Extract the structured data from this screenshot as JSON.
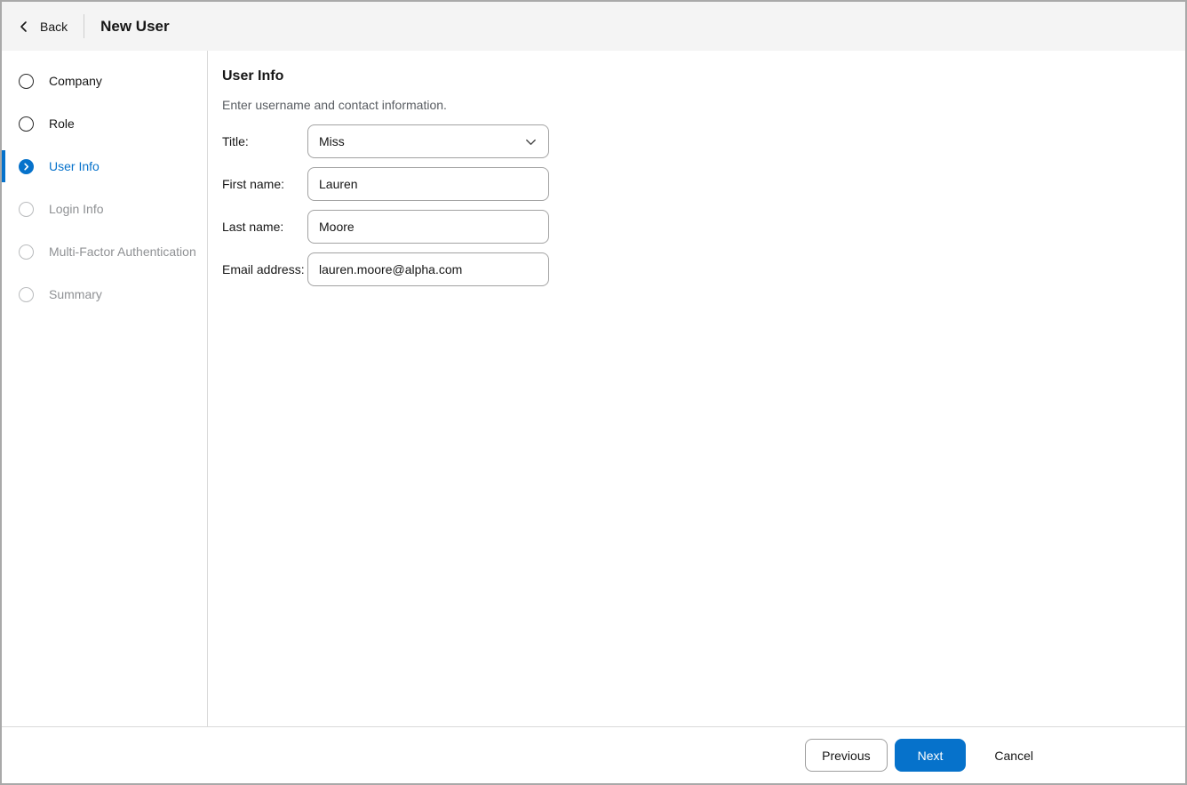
{
  "header": {
    "back_label": "Back",
    "title": "New User"
  },
  "sidebar": {
    "steps": [
      {
        "label": "Company",
        "state": "enabled"
      },
      {
        "label": "Role",
        "state": "enabled"
      },
      {
        "label": "User Info",
        "state": "active"
      },
      {
        "label": "Login Info",
        "state": "disabled"
      },
      {
        "label": "Multi-Factor Authentication",
        "state": "disabled"
      },
      {
        "label": "Summary",
        "state": "disabled"
      }
    ]
  },
  "main": {
    "heading": "User Info",
    "subtitle": "Enter username and contact information.",
    "fields": [
      {
        "label": "Title:",
        "type": "select",
        "value": "Miss"
      },
      {
        "label": "First name:",
        "type": "text",
        "value": "Lauren"
      },
      {
        "label": "Last name:",
        "type": "text",
        "value": "Moore"
      },
      {
        "label": "Email address:",
        "type": "text",
        "value": "lauren.moore@alpha.com"
      }
    ]
  },
  "footer": {
    "previous_label": "Previous",
    "next_label": "Next",
    "cancel_label": "Cancel"
  },
  "icons": {
    "back": "chevron-left",
    "active_step": "chevron-right-circle",
    "title_select": "chevron-down"
  },
  "colors": {
    "accent_blue": "#0672cb",
    "header_bg": "#f4f4f4",
    "divider": "#d9d9d9",
    "disabled_text": "#8f9194",
    "subtitle_text": "#595d62",
    "window_border": "#a9a9a9"
  }
}
